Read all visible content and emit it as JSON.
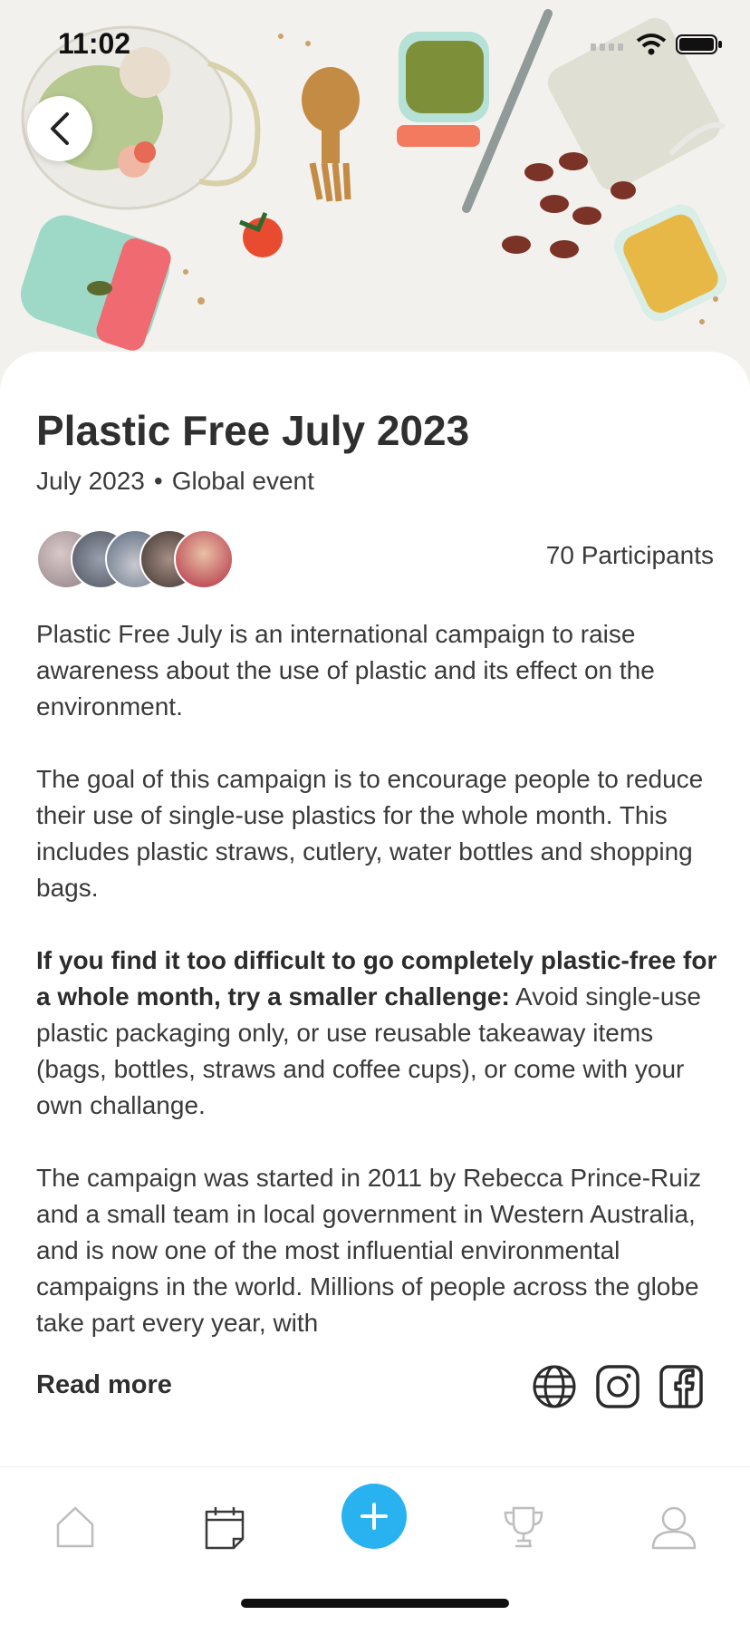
{
  "status_bar": {
    "time": "11:02"
  },
  "event": {
    "title": "Plastic Free July 2023",
    "date": "July 2023",
    "separator": "•",
    "scope": "Global event",
    "participants_label": "70 Participants"
  },
  "description": {
    "p1": "Plastic Free July is an international campaign to raise awareness about the use of plastic and its effect on the environment.",
    "p2": "The goal of this campaign is to encourage people to reduce their use of single-use plastics for the whole month. This includes plastic straws, cutlery, water bottles and shopping bags.",
    "p3_bold": "If you find it too difficult to go completely plastic-free for a whole month, try a smaller challenge:",
    "p3_rest": " Avoid single-use plastic packaging only, or use reusable takeaway items (bags, bottles, straws and coffee cups), or come with your own challange.",
    "p4": "The campaign was started in 2011 by Rebecca Prince-Ruiz and a small team in local government in Western Australia, and is now one of the most influential environmental campaigns in the world. Millions of people across the globe take part every year, with"
  },
  "read_more": "Read more",
  "social_icons": [
    "globe-icon",
    "instagram-icon",
    "facebook-icon"
  ],
  "tab_bar": {
    "items": [
      "home-icon",
      "calendar-icon",
      "add-icon",
      "trophy-icon",
      "profile-icon"
    ],
    "accent": "#29b2f0"
  },
  "colors": {
    "accent": "#29b2f0",
    "text": "#2f2f2f"
  }
}
